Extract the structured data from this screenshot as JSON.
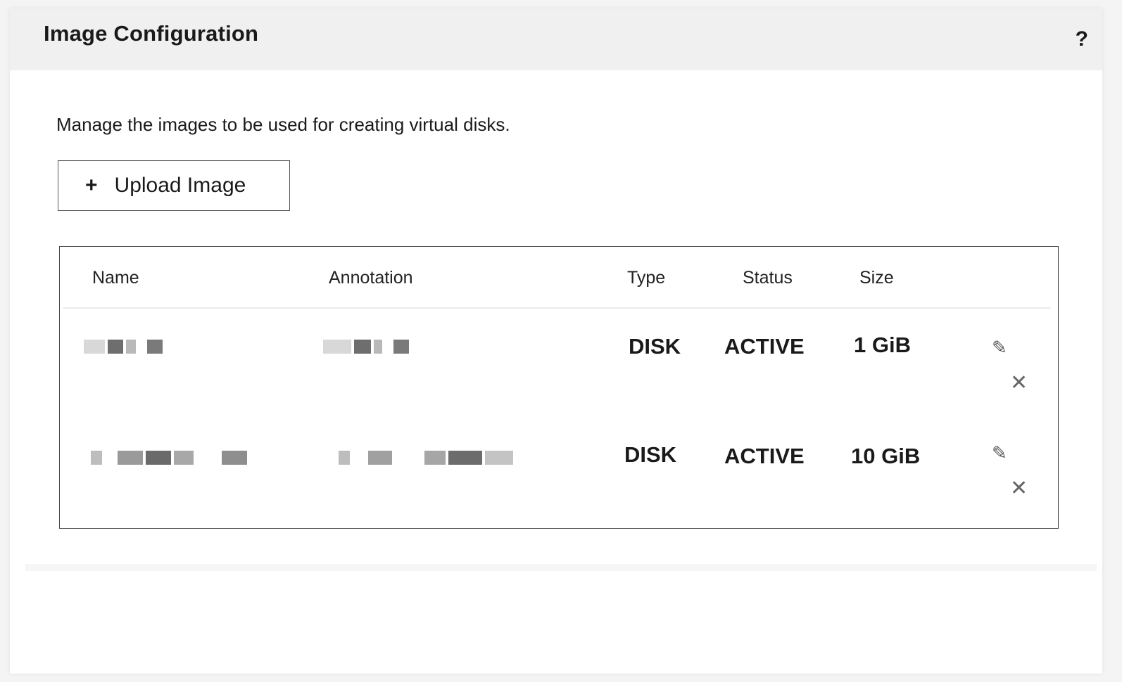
{
  "dialog": {
    "title": "Image Configuration",
    "help": "?"
  },
  "body": {
    "description": "Manage the images to be used for creating virtual disks."
  },
  "upload_button": {
    "icon": "+",
    "label": "Upload Image"
  },
  "table": {
    "headers": {
      "name": "Name",
      "annotation": "Annotation",
      "type": "Type",
      "status": "Status",
      "size": "Size"
    },
    "rows": [
      {
        "type": "DISK",
        "status": "ACTIVE",
        "size": "1 GiB"
      },
      {
        "type": "DISK",
        "status": "ACTIVE",
        "size": "10 GiB"
      }
    ],
    "edit_icon": "✎",
    "delete_icon": "✕"
  }
}
